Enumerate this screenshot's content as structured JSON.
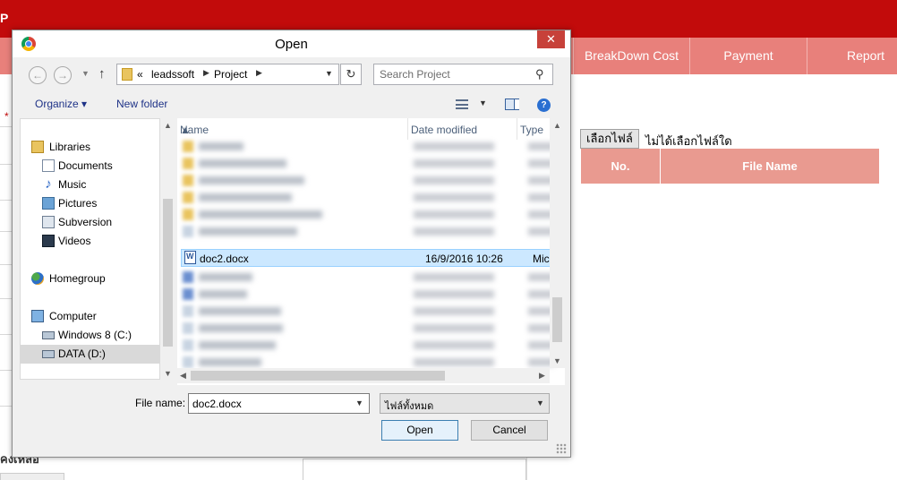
{
  "app": {
    "logo_letter": "P",
    "nav_items": [
      "BreakDown Cost",
      "Payment",
      "Report"
    ],
    "required_mark": "*",
    "bottom_label": "คงเหลือ",
    "file_button_label": "เลือกไฟล์",
    "file_status": "ไม่ได้เลือกไฟล์ใด",
    "table_headers": {
      "no": "No.",
      "file_name": "File Name"
    },
    "colors": {
      "top_bar": "#c20b0b",
      "nav_bar": "#e8807b",
      "table_header": "#e99a90"
    }
  },
  "dialog": {
    "title": "Open",
    "close_glyph": "✕",
    "address": {
      "overflow": "«",
      "crumbs": [
        "leadssoft",
        "Project"
      ]
    },
    "search_placeholder": "Search Project",
    "toolbar": {
      "organize": "Organize ▾",
      "new_folder": "New folder"
    },
    "nav_pane": {
      "libraries": "Libraries",
      "library_items": [
        "Documents",
        "Music",
        "Pictures",
        "Subversion",
        "Videos"
      ],
      "homegroup": "Homegroup",
      "computer": "Computer",
      "drives": [
        "Windows 8 (C:)",
        "DATA (D:)"
      ],
      "selected": "DATA (D:)"
    },
    "columns": {
      "name": "Name",
      "date_modified": "Date modified",
      "type": "Type"
    },
    "selected_file": {
      "name": "doc2.docx",
      "date": "16/9/2016 10:26",
      "type": "Micro"
    },
    "file_name_label": "File name:",
    "file_name_value": "doc2.docx",
    "file_type": "ไฟล์ทั้งหมด",
    "buttons": {
      "open": "Open",
      "cancel": "Cancel"
    }
  }
}
